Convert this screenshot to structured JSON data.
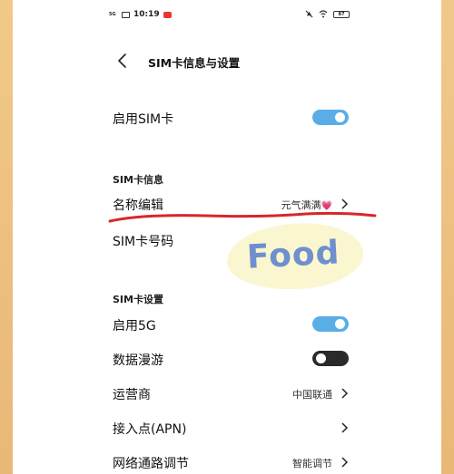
{
  "status_bar": {
    "network": "5G",
    "time": "10:19",
    "battery": "87"
  },
  "header": {
    "title": "SIM卡信息与设置"
  },
  "enable_sim": {
    "label": "启用SIM卡",
    "enabled": true
  },
  "sim_info": {
    "section_title": "SIM卡信息",
    "name_edit": {
      "label": "名称编辑",
      "value": "元气满满"
    },
    "sim_number": {
      "label": "SIM卡号码"
    }
  },
  "sim_settings": {
    "section_title": "SIM卡设置",
    "enable_5g": {
      "label": "启用5G",
      "enabled": true
    },
    "data_roaming": {
      "label": "数据漫游",
      "enabled": false
    },
    "carrier": {
      "label": "运营商",
      "value": "中国联通"
    },
    "apn": {
      "label": "接入点(APN)"
    },
    "network_routing": {
      "label": "网络通路调节",
      "value": "智能调节"
    }
  },
  "sticker": {
    "text": "Food"
  },
  "colors": {
    "toggle_on": "#5aaee6",
    "toggle_off": "#2a2a2a",
    "annotation_red": "#d8262a",
    "frame": "#ecc48a"
  }
}
